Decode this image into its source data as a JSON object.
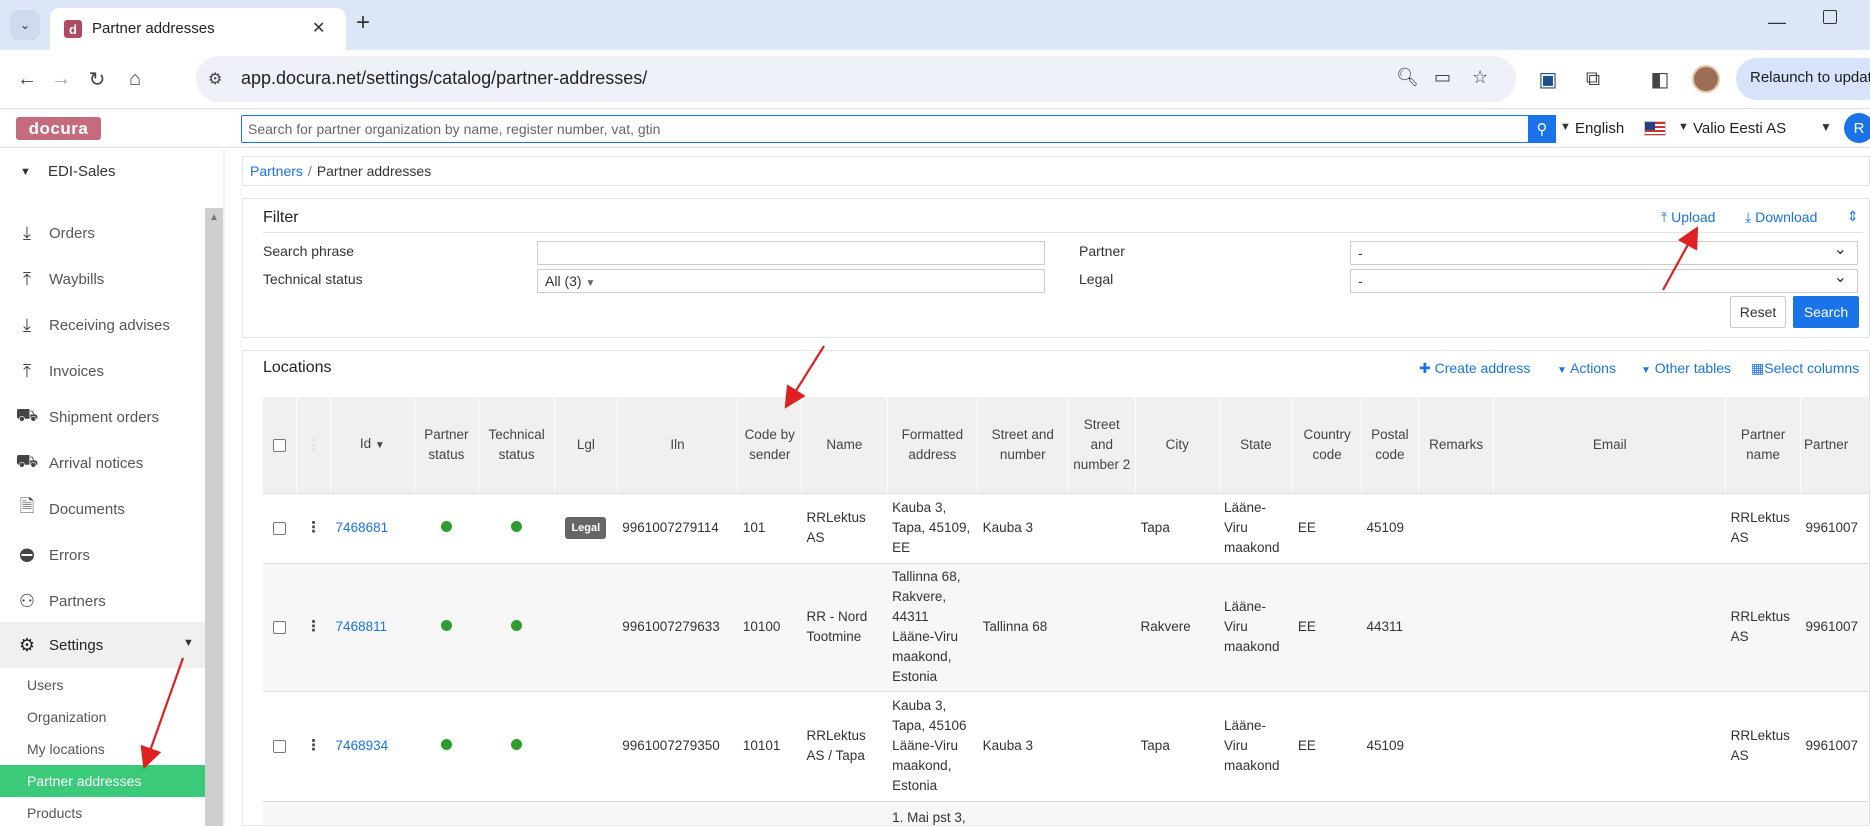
{
  "browser": {
    "tab_title": "Partner addresses",
    "tab_favicon": "d",
    "url": "app.docura.net/settings/catalog/partner-addresses/",
    "relaunch_label": "Relaunch to update"
  },
  "header": {
    "logo": "docura",
    "search_placeholder": "Search for partner organization by name, register number, vat, gtin",
    "language": "English",
    "organization": "Valio Eesti AS",
    "user_initial": "R"
  },
  "sidebar": {
    "module": "EDI-Sales",
    "items": [
      {
        "label": "Orders",
        "icon": "download-tray-icon"
      },
      {
        "label": "Waybills",
        "icon": "upload-tray-icon"
      },
      {
        "label": "Receiving advises",
        "icon": "download-tray-icon"
      },
      {
        "label": "Invoices",
        "icon": "upload-tray-icon"
      },
      {
        "label": "Shipment orders",
        "icon": "truck-icon"
      },
      {
        "label": "Arrival notices",
        "icon": "truck-icon"
      },
      {
        "label": "Documents",
        "icon": "document-icon"
      },
      {
        "label": "Errors",
        "icon": "no-entry-icon"
      },
      {
        "label": "Partners",
        "icon": "people-icon"
      }
    ],
    "settings_label": "Settings",
    "settings_sub": [
      "Users",
      "Organization",
      "My locations",
      "Partner addresses",
      "Products"
    ]
  },
  "breadcrumb": {
    "root": "Partners",
    "current": "Partner addresses"
  },
  "filter": {
    "title": "Filter",
    "upload": "Upload",
    "download": "Download",
    "search_phrase_label": "Search phrase",
    "search_phrase_value": "",
    "technical_status_label": "Technical status",
    "technical_status_value": "All (3)",
    "partner_label": "Partner",
    "partner_value": "-",
    "legal_label": "Legal",
    "legal_value": "-",
    "reset": "Reset",
    "search": "Search"
  },
  "locations": {
    "title": "Locations",
    "create_address": "Create address",
    "actions": "Actions",
    "other_tables": "Other tables",
    "select_columns": "Select columns",
    "columns": [
      "Id",
      "Partner status",
      "Technical status",
      "Lgl",
      "Iln",
      "Code by sender",
      "Name",
      "Formatted address",
      "Street and number",
      "Street and number 2",
      "City",
      "State",
      "Country code",
      "Postal code",
      "Remarks",
      "Email",
      "Partner name",
      "Partner"
    ],
    "rows": [
      {
        "id": "7468681",
        "legal": "Legal",
        "iln": "9961007279114",
        "code": "101",
        "name": "RRLektus AS",
        "formatted": "Kauba 3, Tapa, 45109, EE",
        "street": "Kauba 3",
        "street2": "",
        "city": "Tapa",
        "state": "Lääne-Viru maakond",
        "country": "EE",
        "postal": "45109",
        "remarks": "",
        "email": "",
        "partner_name": "RRLektus AS",
        "partner": "9961007"
      },
      {
        "id": "7468811",
        "legal": "",
        "iln": "9961007279633",
        "code": "10100",
        "name": "RR - Nord Tootmine",
        "formatted": "Tallinna 68, Rakvere, 44311 Lääne-Viru maakond, Estonia",
        "street": "Tallinna 68",
        "street2": "",
        "city": "Rakvere",
        "state": "Lääne-Viru maakond",
        "country": "EE",
        "postal": "44311",
        "remarks": "",
        "email": "",
        "partner_name": "RRLektus AS",
        "partner": "9961007"
      },
      {
        "id": "7468934",
        "legal": "",
        "iln": "9961007279350",
        "code": "10101",
        "name": "RRLektus AS / Tapa",
        "formatted": "Kauba 3, Tapa, 45106 Lääne-Viru maakond, Estonia",
        "street": "Kauba 3",
        "street2": "",
        "city": "Tapa",
        "state": "Lääne-Viru maakond",
        "country": "EE",
        "postal": "45109",
        "remarks": "",
        "email": "",
        "partner_name": "RRLektus AS",
        "partner": "9961007"
      },
      {
        "id": "",
        "legal": "",
        "iln": "",
        "code": "",
        "name": "",
        "formatted": "1. Mai pst 3,",
        "street": "",
        "street2": "",
        "city": "",
        "state": "",
        "country": "",
        "postal": "",
        "remarks": "",
        "email": "",
        "partner_name": "",
        "partner": ""
      }
    ]
  },
  "colors": {
    "accent": "#1a73e8",
    "active_nav": "#3bc97a",
    "status_ok": "#2e9d2e",
    "annotation": "#e02020"
  }
}
